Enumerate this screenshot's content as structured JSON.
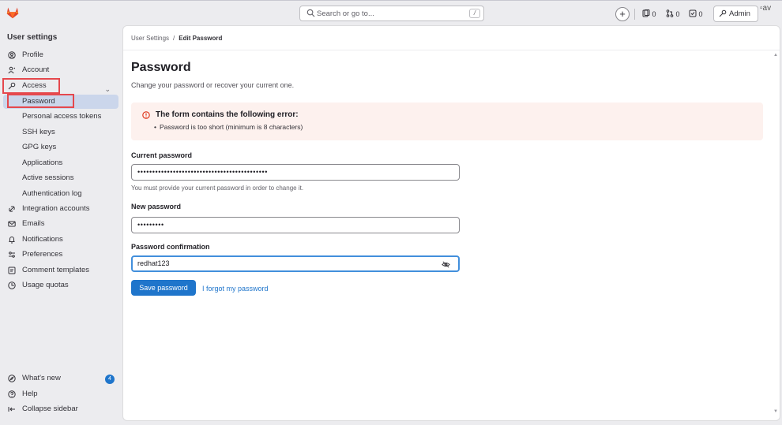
{
  "topbar": {
    "search_placeholder": "Search or go to...",
    "search_shortcut": "/",
    "plus_label": "+",
    "issues_count": "0",
    "merge_requests_count": "0",
    "todos_count": "0",
    "admin_label": "Admin",
    "avatar_alt": "av"
  },
  "sidebar": {
    "title": "User settings",
    "items": [
      {
        "label": "Profile",
        "icon": "profile-icon"
      },
      {
        "label": "Account",
        "icon": "account-icon"
      },
      {
        "label": "Access",
        "icon": "key-icon"
      }
    ],
    "access_sub": [
      {
        "label": "Password"
      },
      {
        "label": "Personal access tokens"
      },
      {
        "label": "SSH keys"
      },
      {
        "label": "GPG keys"
      },
      {
        "label": "Applications"
      },
      {
        "label": "Active sessions"
      },
      {
        "label": "Authentication log"
      }
    ],
    "items_after": [
      {
        "label": "Integration accounts",
        "icon": "link-icon"
      },
      {
        "label": "Emails",
        "icon": "mail-icon"
      },
      {
        "label": "Notifications",
        "icon": "bell-icon"
      },
      {
        "label": "Preferences",
        "icon": "sliders-icon"
      },
      {
        "label": "Comment templates",
        "icon": "comment-icon"
      },
      {
        "label": "Usage quotas",
        "icon": "quota-icon"
      }
    ],
    "footer": [
      {
        "label": "What's new",
        "icon": "compass-icon"
      },
      {
        "label": "Help",
        "icon": "help-icon"
      },
      {
        "label": "Collapse sidebar",
        "icon": "collapse-icon"
      }
    ],
    "whats_new_badge": "4"
  },
  "breadcrumb": {
    "parent": "User Settings",
    "current": "Edit Password"
  },
  "page": {
    "title": "Password",
    "description": "Change your password or recover your current one."
  },
  "alert": {
    "title": "The form contains the following error:",
    "item": "Password is too short (minimum is 8 characters)"
  },
  "form": {
    "current_label": "Current password",
    "current_value": "••••••••••••••••••••••••••••••••••••••••••••",
    "current_help": "You must provide your current password in order to change it.",
    "new_label": "New password",
    "new_value": "•••••••••",
    "confirm_label": "Password confirmation",
    "confirm_value": "redhat123",
    "save_label": "Save password",
    "forgot_label": "I forgot my password"
  },
  "colors": {
    "primary": "#1f75cb",
    "alert_bg": "#fdf1ee",
    "danger": "#dd2b0e",
    "highlight": "#e5484d"
  }
}
